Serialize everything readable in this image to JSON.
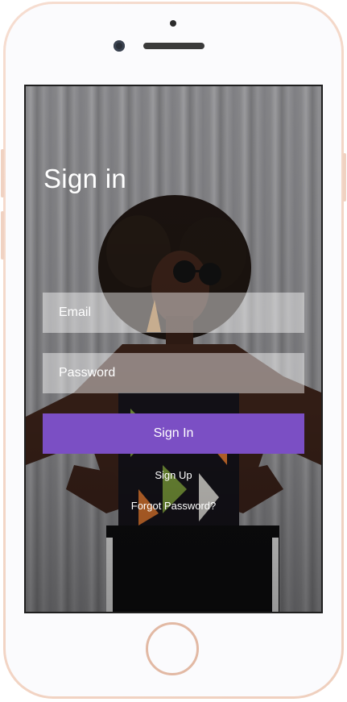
{
  "screen": {
    "title": "Sign in"
  },
  "form": {
    "email_placeholder": "Email",
    "password_placeholder": "Password",
    "submit_label": "Sign In"
  },
  "links": {
    "sign_up": "Sign Up",
    "forgot_password": "Forgot Password?"
  },
  "colors": {
    "accent": "#7b4fc4",
    "phone_frame": "#f3d6c6"
  }
}
